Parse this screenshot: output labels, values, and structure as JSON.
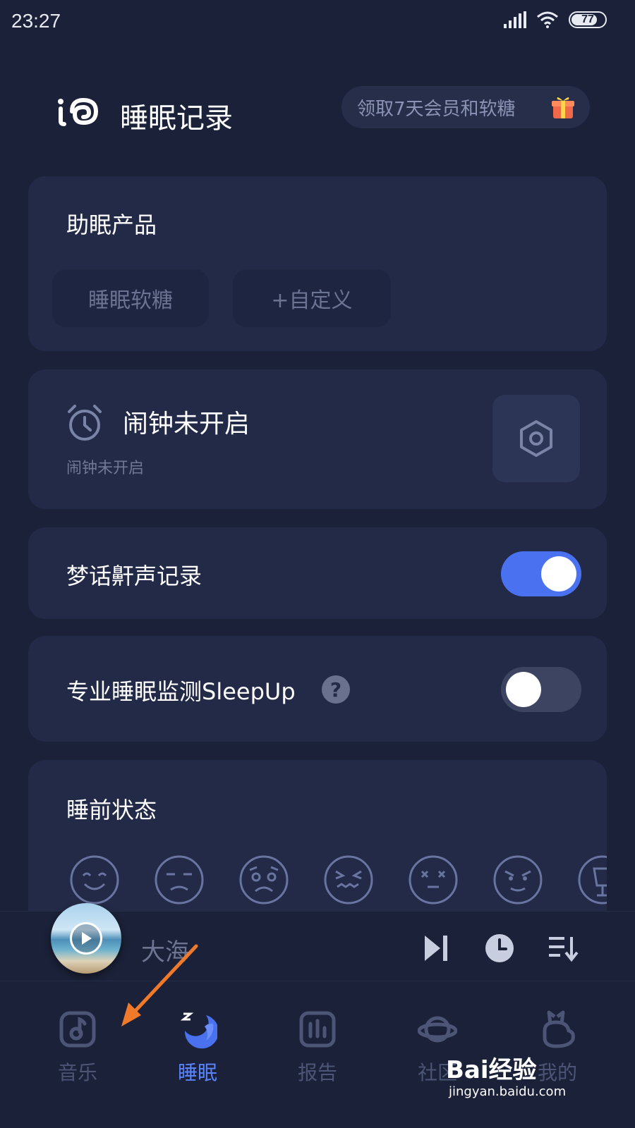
{
  "status_bar": {
    "time": "23:27",
    "battery": "77"
  },
  "header": {
    "title": "睡眠记录",
    "promo_label": "领取7天会员和软糖",
    "logo_icon": "app-logo-icon",
    "gift_icon": "gift-icon"
  },
  "sleep_aids": {
    "title": "助眠产品",
    "chips": [
      "睡眠软糖",
      "+自定义"
    ]
  },
  "alarm": {
    "title": "闹钟未开启",
    "subtitle": "闹钟未开启",
    "icon": "alarm-clock-icon",
    "settings_icon": "hexagon-settings-icon"
  },
  "sleep_talk": {
    "label": "梦话鼾声记录",
    "enabled": true
  },
  "sleepup": {
    "label": "专业睡眠监测SleepUp",
    "help": "?",
    "enabled": false
  },
  "pre_sleep_mood": {
    "title": "睡前状态",
    "moods": [
      "happy-face-icon",
      "sleepy-face-icon",
      "worried-face-icon",
      "stressed-face-icon",
      "dizzy-face-icon",
      "angry-face-icon",
      "drink-icon"
    ]
  },
  "player": {
    "track": "大海",
    "controls": [
      "skip-next-icon",
      "timer-icon",
      "playlist-icon"
    ]
  },
  "bottom_nav": {
    "items": [
      {
        "label": "音乐",
        "icon": "music-note-icon",
        "active": false
      },
      {
        "label": "睡眠",
        "icon": "moon-zzz-icon",
        "active": true
      },
      {
        "label": "报告",
        "icon": "bar-chart-icon",
        "active": false
      },
      {
        "label": "社区",
        "icon": "planet-icon",
        "active": false
      },
      {
        "label": "我的",
        "icon": "bunny-icon",
        "active": false
      }
    ]
  },
  "colors": {
    "background": "#1b2138",
    "card": "#232a47",
    "accent": "#4a72f0",
    "arrow": "#f07a2a"
  },
  "watermark": {
    "brand": "Bai经验",
    "url": "jingyan.baidu.com"
  }
}
